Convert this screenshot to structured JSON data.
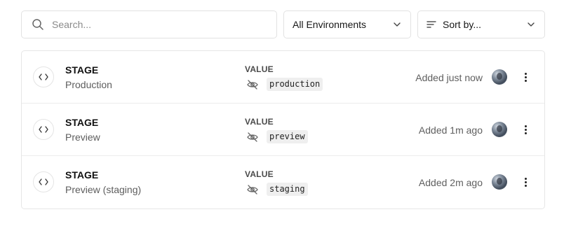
{
  "toolbar": {
    "search_placeholder": "Search...",
    "environment_select": "All Environments",
    "sort_select": "Sort by..."
  },
  "rows": [
    {
      "name": "STAGE",
      "environment": "Production",
      "value_label": "VALUE",
      "value": "production",
      "added": "Added just now"
    },
    {
      "name": "STAGE",
      "environment": "Preview",
      "value_label": "VALUE",
      "value": "preview",
      "added": "Added 1m ago"
    },
    {
      "name": "STAGE",
      "environment": "Preview (staging)",
      "value_label": "VALUE",
      "value": "staging",
      "added": "Added 2m ago"
    }
  ],
  "icons": {
    "search": "search-icon",
    "chevron": "chevron-down-icon",
    "sort": "sort-lines-icon",
    "code": "code-brackets-icon",
    "hidden": "eye-off-icon",
    "more": "more-vertical-icon"
  }
}
